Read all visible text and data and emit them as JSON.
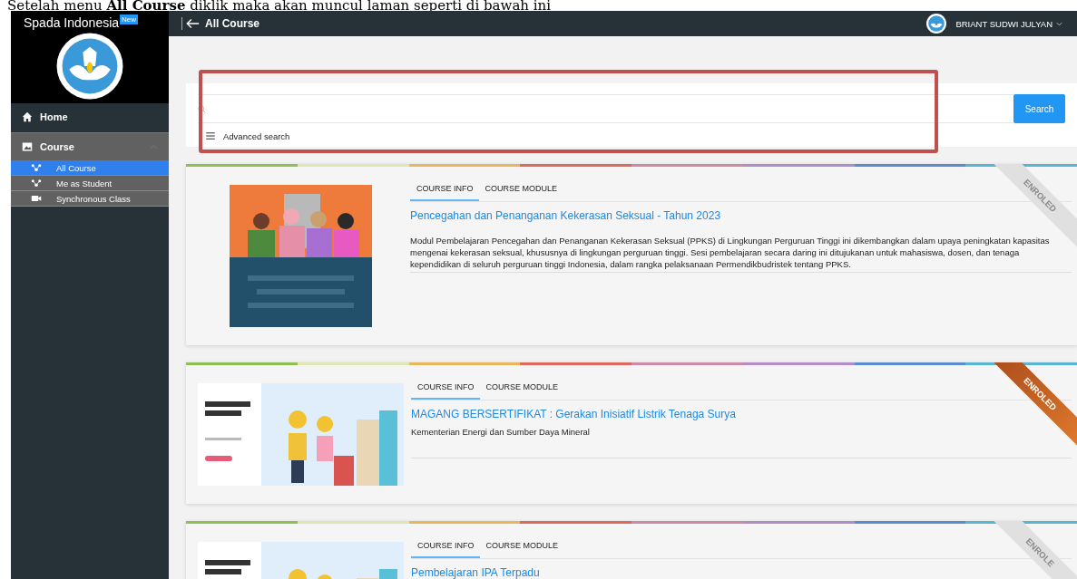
{
  "caption": "Setelah menu **All Course** diklik maka akan muncul laman seperti di bawah ini",
  "sidebar": {
    "brand": "Spada Indonesia",
    "badge": "New",
    "items": [
      {
        "label": "Home",
        "selected": false
      },
      {
        "label": "Course",
        "selected": false,
        "expanded": true,
        "children": [
          {
            "label": "All Course",
            "selected": true
          },
          {
            "label": "Me as Student",
            "selected": false
          },
          {
            "label": "Synchronous Class",
            "selected": false
          }
        ]
      }
    ]
  },
  "topbar": {
    "title": "All Course",
    "user": "BRIANT SUDWI JULYAN"
  },
  "search": {
    "button": "Search",
    "advanced": "Advanced search"
  },
  "courses": [
    {
      "tabs": [
        {
          "label": "COURSE INFO",
          "selected": true
        },
        {
          "label": "COURSE MODULE",
          "selected": false
        }
      ],
      "title": "Pencegahan dan Penanganan Kekerasan Seksual - Tahun 2023",
      "description": "Modul Pembelajaran Pencegahan dan Penanganan Kekerasan Seksual (PPKS) di Lingkungan Perguruan Tinggi ini dikembangkan dalam upaya peningkatan kapasitas mengenai kekerasan seksual, khususnya di lingkungan perguruan tinggi. Sesi pembelajaran secara daring ini ditujukanan untuk mahasiswa, dosen, dan tenaga kependidikan di seluruh perguruan tinggi Indonesia, dalam rangka pelaksanaan Permendikbudristek tentang PPKS.",
      "ribbon": "ENROLED",
      "enroled": false
    },
    {
      "tabs": [
        {
          "label": "COURSE INFO",
          "selected": true
        },
        {
          "label": "COURSE MODULE",
          "selected": false
        }
      ],
      "title": "MAGANG BERSERTIFIKAT : Gerakan Inisiatif Listrik Tenaga Surya",
      "description": "Kementerian Energi dan Sumber Daya Mineral",
      "ribbon": "ENROLED",
      "enroled": true
    },
    {
      "tabs": [
        {
          "label": "COURSE INFO",
          "selected": true
        },
        {
          "label": "COURSE MODULE",
          "selected": false
        }
      ],
      "title": "Pembelajaran IPA Terpadu",
      "ribbon": "ENROLE",
      "enroled": false
    }
  ]
}
